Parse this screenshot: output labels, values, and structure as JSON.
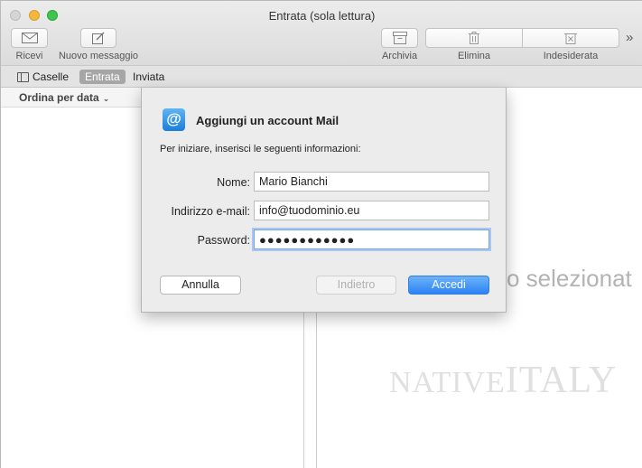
{
  "window": {
    "title": "Entrata (sola lettura)"
  },
  "toolbar": {
    "get_mail_label": "Ricevi",
    "new_message_label": "Nuovo messaggio",
    "archive_label": "Archivia",
    "delete_label": "Elimina",
    "junk_label": "Indesiderata",
    "more_glyph": "»"
  },
  "favorites": {
    "mailboxes_label": "Caselle",
    "inbox_label": "Entrata",
    "sent_label": "Inviata"
  },
  "list": {
    "sort_label": "Ordina per data"
  },
  "message_pane": {
    "empty_text": "o selezionat",
    "watermark_native": "NATIVE",
    "watermark_italy": "ITALY"
  },
  "dialog": {
    "icon_glyph": "@",
    "title": "Aggiungi un account Mail",
    "subtitle": "Per iniziare, inserisci le seguenti informazioni:",
    "name_label": "Nome:",
    "name_value": "Mario Bianchi",
    "email_label": "Indirizzo e-mail:",
    "email_value": "info@tuodominio.eu",
    "password_label": "Password:",
    "password_value": "●●●●●●●●●●●●",
    "cancel_label": "Annulla",
    "back_label": "Indietro",
    "signin_label": "Accedi"
  }
}
